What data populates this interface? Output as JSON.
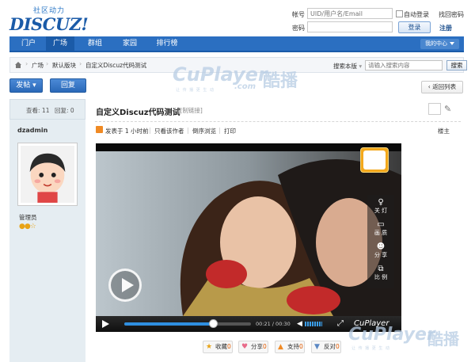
{
  "brand": {
    "tagline": "社区动力",
    "logo": "DISCUZ!"
  },
  "login": {
    "account_label": "帐号",
    "account_placeholder": "UID/用户名/Email",
    "password_label": "密码",
    "auto_login": "自动登录",
    "find_password": "找回密码",
    "login_button": "登录",
    "register": "注册"
  },
  "nav": {
    "items": [
      "门户",
      "广场",
      "群组",
      "家园",
      "排行榜"
    ],
    "active_index": 1,
    "my_center": "我的中心"
  },
  "breadcrumb": {
    "items": [
      "广场",
      "默认版块",
      "自定义Discuz代码测试"
    ],
    "scope": "搜索本版",
    "search_placeholder": "请输入搜索内容",
    "search_button": "搜索"
  },
  "watermark": {
    "en": "CuPlayer",
    "com": ".com",
    "cn": "酷播",
    "sub": "让 传 播 更 生 动"
  },
  "actions": {
    "post": "发帖",
    "reply": "回复",
    "back_list": "返回列表"
  },
  "sidebar": {
    "views_label": "查看:",
    "views": "11",
    "replies_label": "回复:",
    "replies": "0",
    "username": "dzadmin",
    "role": "管理员"
  },
  "post": {
    "title": "自定义Discuz代码测试",
    "copy_link": "[复制链接]",
    "meta": [
      "发表于 1 小时前",
      "只看该作者",
      "倒序浏览",
      "打印"
    ],
    "floor": "楼主"
  },
  "player": {
    "side_controls": [
      {
        "icon": "bulb-icon",
        "glyph": "♀",
        "label": "关 灯"
      },
      {
        "icon": "monitor-icon",
        "glyph": "▭",
        "label": "画 质"
      },
      {
        "icon": "people-icon",
        "glyph": "☻",
        "label": "分 享"
      },
      {
        "icon": "ratio-icon",
        "glyph": "⧉",
        "label": "比 例"
      }
    ],
    "time": "00:21 / 00:30",
    "progress": 0.7,
    "brand": "CuPlayer"
  },
  "post_actions": [
    {
      "label": "收藏",
      "count": "0",
      "glyph": "★",
      "color": "#e8a316"
    },
    {
      "label": "分享",
      "count": "0",
      "glyph": "♥",
      "color": "#e86b8a"
    },
    {
      "label": "支持",
      "count": "0",
      "glyph": "▲",
      "color": "#f08a24"
    },
    {
      "label": "反对",
      "count": "0",
      "glyph": "▼",
      "color": "#5b88c4"
    }
  ],
  "colors": {
    "nav": "#2b6fc1",
    "nav_dark": "#1b5ba8",
    "side": "#e5edf2",
    "accent": "#f08a24"
  }
}
